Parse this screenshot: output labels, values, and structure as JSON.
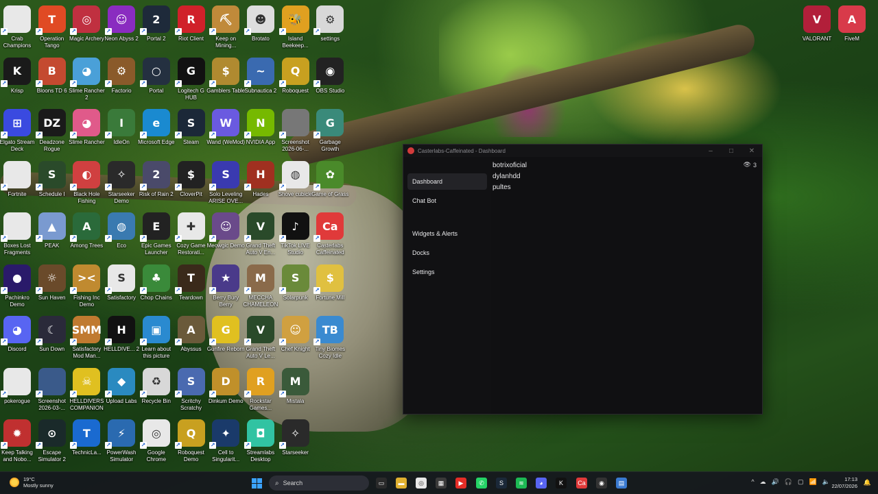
{
  "desktop": {
    "icons": [
      {
        "label": "Crab Champions",
        "color": "#e8e8e8",
        "glyph": ""
      },
      {
        "label": "Operation Tango",
        "color": "#e04a24",
        "glyph": "T"
      },
      {
        "label": "Magic Archery",
        "color": "#c03040",
        "glyph": "◎"
      },
      {
        "label": "Neon Abyss 2",
        "color": "#8a2cc0",
        "glyph": "☺"
      },
      {
        "label": "Portal 2",
        "color": "#1e2a3a",
        "glyph": "2"
      },
      {
        "label": "Riot Client",
        "color": "#d0212a",
        "glyph": "R"
      },
      {
        "label": "Keep on Mining...",
        "color": "#c08a3a",
        "glyph": "⛏"
      },
      {
        "label": "Brotato",
        "color": "#ddd",
        "glyph": "☻"
      },
      {
        "label": "Island Beekeep...",
        "color": "#e0a020",
        "glyph": "🐝"
      },
      {
        "label": "settings",
        "color": "#d8d8d8",
        "glyph": "⚙"
      },
      {
        "label": "Krisp",
        "color": "#1a1a1a",
        "glyph": "K"
      },
      {
        "label": "Bloons TD 6",
        "color": "#c44a30",
        "glyph": "B"
      },
      {
        "label": "Slime Rancher 2",
        "color": "#4aa0d8",
        "glyph": "◕"
      },
      {
        "label": "Factorio",
        "color": "#8a5a2a",
        "glyph": "⚙"
      },
      {
        "label": "Portal",
        "color": "#243040",
        "glyph": "○"
      },
      {
        "label": "Logitech G HUB",
        "color": "#111",
        "glyph": "G"
      },
      {
        "label": "Gamblers Table",
        "color": "#b08a30",
        "glyph": "$"
      },
      {
        "label": "Subnautica 2",
        "color": "#3a6ab0",
        "glyph": "~"
      },
      {
        "label": "Roboquest",
        "color": "#c8a020",
        "glyph": "Q"
      },
      {
        "label": "OBS Studio",
        "color": "#222",
        "glyph": "◉"
      },
      {
        "label": "Elgato Stream Deck",
        "color": "#3a4ae0",
        "glyph": "⊞"
      },
      {
        "label": "Deadzone Rogue",
        "color": "#1a1a1a",
        "glyph": "DZ"
      },
      {
        "label": "Slime Rancher",
        "color": "#e05a8a",
        "glyph": "◕"
      },
      {
        "label": "IdleOn",
        "color": "#3a7a3a",
        "glyph": "I"
      },
      {
        "label": "Microsoft Edge",
        "color": "#1a8ad0",
        "glyph": "e"
      },
      {
        "label": "Steam",
        "color": "#1b2838",
        "glyph": "S"
      },
      {
        "label": "Wand (WeMod)",
        "color": "#6a5ae0",
        "glyph": "W"
      },
      {
        "label": "NVIDIA App",
        "color": "#76b900",
        "glyph": "N"
      },
      {
        "label": "Screenshot 2026-06-...",
        "color": "#777",
        "glyph": ""
      },
      {
        "label": "Garbage Growth",
        "color": "#3a8a7a",
        "glyph": "G"
      },
      {
        "label": "Fortnite",
        "color": "#e8e8e8",
        "glyph": ""
      },
      {
        "label": "Schedule I",
        "color": "#2a4a2a",
        "glyph": "S"
      },
      {
        "label": "Black Hole Fishing",
        "color": "#d04040",
        "glyph": "◐"
      },
      {
        "label": "Starseeker Demo",
        "color": "#2a2a2a",
        "glyph": "✧"
      },
      {
        "label": "Risk of Rain 2",
        "color": "#4a4a6a",
        "glyph": "2"
      },
      {
        "label": "CloverPit",
        "color": "#222",
        "glyph": "$"
      },
      {
        "label": "Solo Leveling ARISE OVE...",
        "color": "#3a3ab0",
        "glyph": "S"
      },
      {
        "label": "Hades",
        "color": "#a03020",
        "glyph": "H"
      },
      {
        "label": "Shove cubicle",
        "color": "#e8e8e8",
        "glyph": "◍"
      },
      {
        "label": "Game of Grass",
        "color": "#4a8a2a",
        "glyph": "✿"
      },
      {
        "label": "Boxes Lost Fragments",
        "color": "#e8e8e8",
        "glyph": ""
      },
      {
        "label": "PEAK",
        "color": "#7a9ad0",
        "glyph": "▲"
      },
      {
        "label": "Among Trees",
        "color": "#2a6a3a",
        "glyph": "A"
      },
      {
        "label": "Eco",
        "color": "#3a7ab0",
        "glyph": "◍"
      },
      {
        "label": "Epic Games Launcher",
        "color": "#222",
        "glyph": "E"
      },
      {
        "label": "Cozy Game Restorati...",
        "color": "#e8e8e8",
        "glyph": "✚"
      },
      {
        "label": "Meowgic Demo",
        "color": "#6a4a8a",
        "glyph": "☺"
      },
      {
        "label": "Grand Theft Auto V En...",
        "color": "#2a4a2a",
        "glyph": "V"
      },
      {
        "label": "TikTok LIVE Studio",
        "color": "#111",
        "glyph": "♪"
      },
      {
        "label": "Casterlabs Caffeinated",
        "color": "#e03a3a",
        "glyph": "Ca"
      },
      {
        "label": "Pachinkro Demo",
        "color": "#2a1a6a",
        "glyph": "●"
      },
      {
        "label": "Sun Haven",
        "color": "#6a4a2a",
        "glyph": "☼"
      },
      {
        "label": "Fishing Inc Demo",
        "color": "#c08a30",
        "glyph": "><"
      },
      {
        "label": "Satisfactory",
        "color": "#e8e8e8",
        "glyph": "S"
      },
      {
        "label": "Chop Chains",
        "color": "#3a8a3a",
        "glyph": "♣"
      },
      {
        "label": "Teardown",
        "color": "#3a2a1a",
        "glyph": "T"
      },
      {
        "label": "Berry Bury Berry",
        "color": "#4a3a8a",
        "glyph": "★"
      },
      {
        "label": "MECCHA CHAMELEON",
        "color": "#8a6a4a",
        "glyph": "M"
      },
      {
        "label": "Solarpunk",
        "color": "#6a8a3a",
        "glyph": "S"
      },
      {
        "label": "Fortune Mill",
        "color": "#e0c040",
        "glyph": "$"
      },
      {
        "label": "Discord",
        "color": "#5865f2",
        "glyph": "◕"
      },
      {
        "label": "Sun Down",
        "color": "#2a2a3a",
        "glyph": "☾"
      },
      {
        "label": "Satisfactory Mod Man...",
        "color": "#c07a30",
        "glyph": "SMM"
      },
      {
        "label": "HELLDIVE... 2",
        "color": "#111",
        "glyph": "H"
      },
      {
        "label": "Learn about this picture",
        "color": "#2a8ad0",
        "glyph": "▣"
      },
      {
        "label": "Abyssus",
        "color": "#6a5a3a",
        "glyph": "A"
      },
      {
        "label": "Gunfire Reborn",
        "color": "#e0c020",
        "glyph": "G"
      },
      {
        "label": "Grand Theft Auto V Le...",
        "color": "#2a4a2a",
        "glyph": "V"
      },
      {
        "label": "Chef Knight",
        "color": "#d0a040",
        "glyph": "☺"
      },
      {
        "label": "Tiny Biomes Cozy Idle",
        "color": "#3a8ad0",
        "glyph": "TB"
      },
      {
        "label": "pokerogue",
        "color": "#e8e8e8",
        "glyph": ""
      },
      {
        "label": "Screenshot 2026-03-...",
        "color": "#3a5a8a",
        "glyph": ""
      },
      {
        "label": "HELLDIVERS COMPANION",
        "color": "#e0c020",
        "glyph": "☠"
      },
      {
        "label": "Upload Labs",
        "color": "#2a8ac0",
        "glyph": "◆"
      },
      {
        "label": "Recycle Bin",
        "color": "#d8d8d8",
        "glyph": "♻"
      },
      {
        "label": "Scritchy Scratchy",
        "color": "#4a6ab0",
        "glyph": "S"
      },
      {
        "label": "Dinkum Demo",
        "color": "#c0902a",
        "glyph": "D"
      },
      {
        "label": "Rockstar Games...",
        "color": "#e0a020",
        "glyph": "R"
      },
      {
        "label": "Mistala",
        "color": "#3a5a3a",
        "glyph": "M"
      },
      {
        "label": "",
        "color": "transparent",
        "glyph": ""
      },
      {
        "label": "Keep Talking and Nobo...",
        "color": "#c03030",
        "glyph": "✹"
      },
      {
        "label": "Escape Simulator 2",
        "color": "#1a2a2a",
        "glyph": "⊙"
      },
      {
        "label": "TechnicLa...",
        "color": "#1a6ad0",
        "glyph": "T"
      },
      {
        "label": "PowerWash Simulator",
        "color": "#2a6ab0",
        "glyph": "⚡"
      },
      {
        "label": "Google Chrome",
        "color": "#e8e8e8",
        "glyph": "◎"
      },
      {
        "label": "Roboquest Demo",
        "color": "#c8a020",
        "glyph": "Q"
      },
      {
        "label": "Cell to Singularit...",
        "color": "#1a3a6a",
        "glyph": "✦"
      },
      {
        "label": "Streamlabs Desktop",
        "color": "#31c3a2",
        "glyph": "◘"
      },
      {
        "label": "Starseeker",
        "color": "#2a2a2a",
        "glyph": "✧"
      },
      {
        "label": "",
        "color": "transparent",
        "glyph": ""
      }
    ],
    "right_icons": [
      {
        "label": "VALORANT",
        "color": "#b21f3a",
        "glyph": "V"
      },
      {
        "label": "FiveM",
        "color": "#d83a4a",
        "glyph": "A"
      }
    ]
  },
  "window": {
    "title": "Casterlabs-Caffeinated - Dashboard",
    "controls": {
      "minimize": "–",
      "maximize": "□",
      "close": "✕"
    },
    "nav": [
      {
        "label": "Dashboard",
        "active": true
      },
      {
        "label": "Chat Bot",
        "active": false
      },
      {
        "label": "Widgets & Alerts",
        "active": false
      },
      {
        "label": "Docks",
        "active": false
      },
      {
        "label": "Settings",
        "active": false
      }
    ],
    "viewers": [
      "botrixoficial",
      "dylanhdd",
      "pultes"
    ],
    "viewer_count": "3"
  },
  "taskbar": {
    "weather_temp": "19°C",
    "weather_desc": "Mostly sunny",
    "search_label": "Search",
    "time": "17:13",
    "date": "22/07/2026",
    "pinned": [
      {
        "name": "file-explorer",
        "color": "#2a2a2a",
        "glyph": "▭"
      },
      {
        "name": "folder",
        "color": "#e0b030",
        "glyph": "▬"
      },
      {
        "name": "chrome",
        "color": "#e8e8e8",
        "glyph": "◎"
      },
      {
        "name": "store",
        "color": "#3a3a3a",
        "glyph": "▦"
      },
      {
        "name": "youtube",
        "color": "#e52d27",
        "glyph": "▶"
      },
      {
        "name": "whatsapp",
        "color": "#25d366",
        "glyph": "✆"
      },
      {
        "name": "steam",
        "color": "#1b2838",
        "glyph": "S"
      },
      {
        "name": "spotify",
        "color": "#1db954",
        "glyph": "≋"
      },
      {
        "name": "discord",
        "color": "#5865f2",
        "glyph": "◕"
      },
      {
        "name": "krisp",
        "color": "#111",
        "glyph": "K"
      },
      {
        "name": "casterlabs",
        "color": "#e03a3a",
        "glyph": "Ca"
      },
      {
        "name": "obs",
        "color": "#333",
        "glyph": "◉"
      },
      {
        "name": "notepad",
        "color": "#3a7ad0",
        "glyph": "▤"
      }
    ],
    "tray": [
      "^",
      "☁",
      "🔊",
      "🎧",
      "▢",
      "📶",
      "🔈"
    ]
  }
}
